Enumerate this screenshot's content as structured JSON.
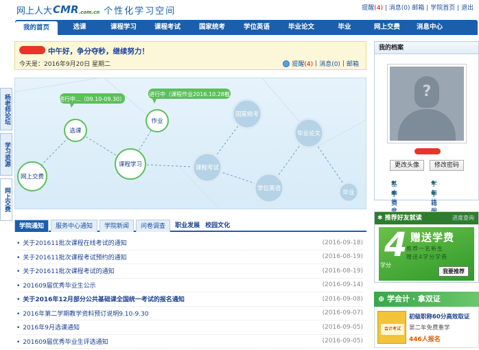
{
  "header": {
    "logo_text": "网上人大",
    "logo_brand": "CMR",
    "logo_domain": ".com.cn",
    "slogan": "个性化学习空间",
    "links": {
      "remind": "提醒",
      "remind_count": "(4)",
      "messages": "消息(0)",
      "mail": "邮箱",
      "home": "学院首页",
      "logout": "退出"
    }
  },
  "nav": [
    "我的首页",
    "选课",
    "课程学习",
    "课程考试",
    "国家统考",
    "学位英语",
    "毕业论文",
    "毕业",
    "网上交费",
    "消息中心"
  ],
  "greeting": {
    "message": "中午好，争分夺秒，继续努力！",
    "date": "今天是：2016年9月20日 星期二",
    "remind": "提醒",
    "remind_count": "(4)",
    "messages": "消息(0)",
    "mail": "邮箱"
  },
  "side_tabs": [
    "杨老师论坛",
    "学习资源",
    "网上交费"
  ],
  "map": {
    "nodes": {
      "select": "选课",
      "homework": "作业",
      "study": "课程学习",
      "payment": "网上交费",
      "exam": "课程考试",
      "national": "国家统考",
      "english": "学位英语",
      "thesis": "毕业论文",
      "graduate": "毕业"
    },
    "bubbles": {
      "select": "进行中...（09.10-09.30）",
      "homework": "进行中（课程作业2016.10.28截"
    }
  },
  "news_tabs": [
    "学院通知",
    "服务中心通知",
    "学院新闻",
    "问卷调查",
    "职业发展",
    "校园文化"
  ],
  "news": [
    {
      "title": "关于201611批次课程在线考试的通知",
      "date": "(2016-09-18)",
      "bold": false
    },
    {
      "title": "关于201611批次课程考试预约的通知",
      "date": "(2016-08-19)",
      "bold": false
    },
    {
      "title": "关于201611批次课程考试的通知",
      "date": "(2016-08-19)",
      "bold": false
    },
    {
      "title": "201609届优秀毕业生公示",
      "date": "(2016-09-14)",
      "bold": false
    },
    {
      "title": "关于2016年12月部分公共基础课全国统一考试的报名通知",
      "date": "(2016-09-08)",
      "bold": true
    },
    {
      "title": "2016年第二学期教学资料预订说明9.10-9.30",
      "date": "(2016-09-07)",
      "bold": false
    },
    {
      "title": "2016年9月选课通知",
      "date": "(2016-09-05)",
      "bold": false
    },
    {
      "title": "201609届优秀毕业生评选通知",
      "date": "(2016-09-05)",
      "bold": false
    }
  ],
  "profile": {
    "title": "我的档案",
    "change_avatar": "更改头像",
    "change_password": "修改密码",
    "links": [
      "基本信息",
      "学年注册",
      "学费账户",
      "学籍信息"
    ]
  },
  "invite": {
    "title": "推荐好友就读",
    "more": "进度查询",
    "number": "4",
    "headline": "赠送学费",
    "line1": "推荐一名新生",
    "line2": "赠送4学分学费",
    "unit": "学分",
    "button": "我要推荐"
  },
  "accounting": {
    "title": "学会计 · 拿双证",
    "book_text": "会计考试",
    "line1": "初级职称60分高效取证",
    "line2": "第二年免费重学",
    "line3": "446人报名"
  },
  "colors": {
    "nav": "#1a5eac",
    "accent": "#e8352a",
    "green": "#2e7d2e"
  }
}
